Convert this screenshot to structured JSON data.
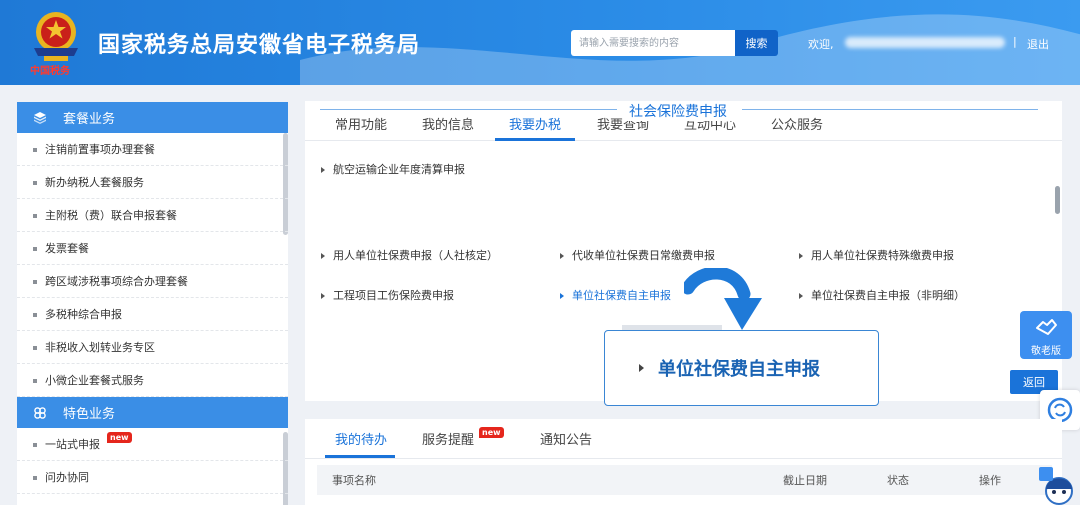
{
  "header": {
    "title": "国家税务总局安徽省电子税务局",
    "brand_sub": "中国税务",
    "search_placeholder": "请输入需要搜索的内容",
    "search_button": "搜索",
    "welcome": "欢迎,",
    "separator": "|",
    "logout": "退出"
  },
  "sidebar": {
    "section1": {
      "title": "套餐业务",
      "icon": "cube-icon"
    },
    "items1": [
      "注销前置事项办理套餐",
      "新办纳税人套餐服务",
      "主附税（费）联合申报套餐",
      "发票套餐",
      "跨区域涉税事项综合办理套餐",
      "多税种综合申报",
      "非税收入划转业务专区",
      "小微企业套餐式服务"
    ],
    "section2": {
      "title": "特色业务",
      "icon": "flower-icon"
    },
    "items2": [
      {
        "label": "一站式申报",
        "badge": "new"
      },
      {
        "label": "问办协同"
      }
    ]
  },
  "main": {
    "tabs": [
      "常用功能",
      "我的信息",
      "我要办税",
      "我要查询",
      "互动中心",
      "公众服务"
    ],
    "active_tab": "我要办税",
    "top_item": "航空运输企业年度清算申报",
    "section_title": "社会保险费申报",
    "items": [
      "用人单位社保费申报（人社核定）",
      "代收单位社保费日常缴费申报",
      "用人单位社保费特殊缴费申报",
      "工程项目工伤保险费申报",
      "单位社保费自主申报",
      "单位社保费自主申报（非明细）"
    ],
    "return_button": "返回"
  },
  "callout": {
    "text": "单位社保费自主申报"
  },
  "floating": {
    "elder_label": "敬老版"
  },
  "bottom": {
    "tabs": [
      {
        "label": "我的待办"
      },
      {
        "label": "服务提醒",
        "badge": "new"
      },
      {
        "label": "通知公告"
      }
    ],
    "columns": [
      "事项名称",
      "截止日期",
      "状态",
      "操作"
    ]
  },
  "colors": {
    "primary": "#1a73d9",
    "header": "#2a8be6",
    "badge": "#e5261c"
  }
}
